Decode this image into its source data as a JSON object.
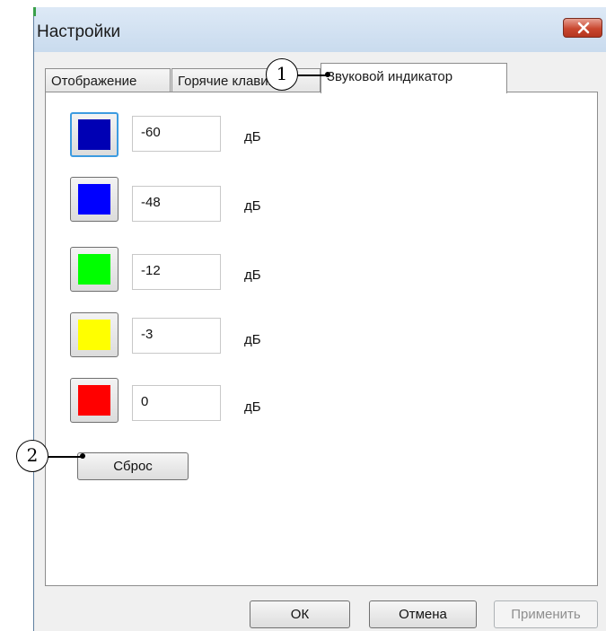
{
  "window": {
    "title": "Настройки",
    "close_icon": "close-icon"
  },
  "tabs": [
    {
      "label": "Отображение",
      "active": false
    },
    {
      "label": "Горячие клавиши",
      "active": false
    },
    {
      "label": "Звуковой индикатор",
      "active": true
    }
  ],
  "levels": [
    {
      "color": "#0000b4",
      "value": "-60",
      "unit": "дБ",
      "focused": true
    },
    {
      "color": "#0000ff",
      "value": "-48",
      "unit": "дБ",
      "focused": false
    },
    {
      "color": "#00ff00",
      "value": "-12",
      "unit": "дБ",
      "focused": false
    },
    {
      "color": "#ffff00",
      "value": "-3",
      "unit": "дБ",
      "focused": false
    },
    {
      "color": "#ff0000",
      "value": "0",
      "unit": "дБ",
      "focused": false
    }
  ],
  "reset_label": "Сброс",
  "footer": {
    "ok_label": "ОК",
    "cancel_label": "Отмена",
    "apply_label": "Применить"
  },
  "callouts": {
    "tab_marker": "1",
    "reset_marker": "2"
  }
}
